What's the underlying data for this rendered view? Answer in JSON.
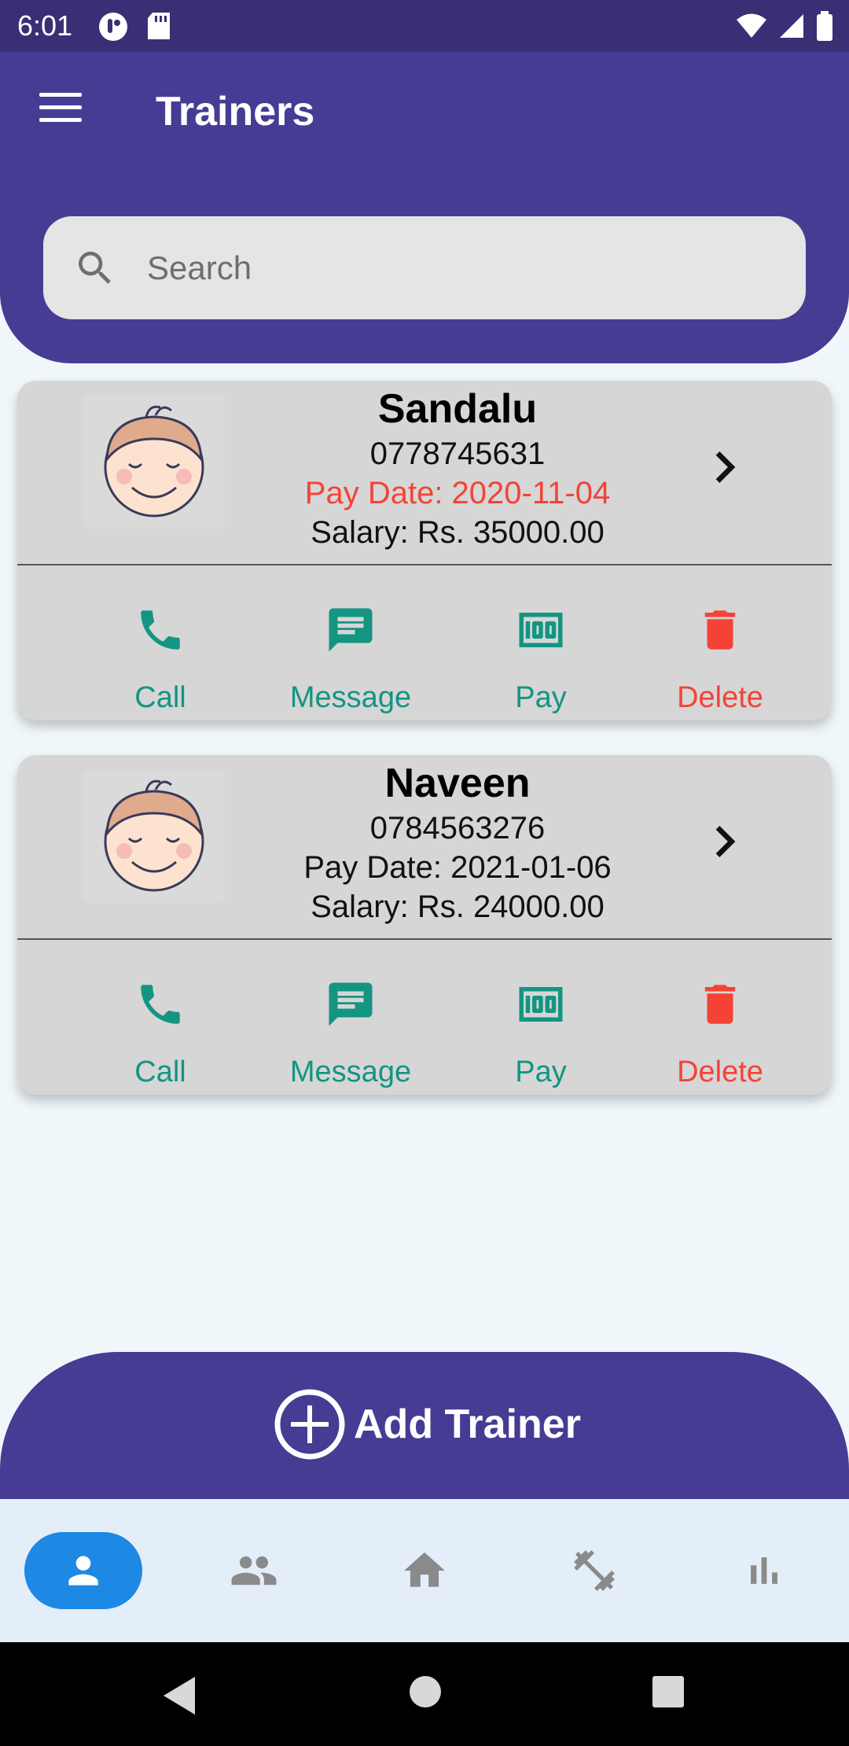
{
  "status_bar": {
    "time": "6:01"
  },
  "header": {
    "title": "Trainers",
    "search_placeholder": "Search"
  },
  "trainers": [
    {
      "name": "Sandalu",
      "phone": "0778745631",
      "pay_date": "Pay Date: 2020-11-04",
      "pay_date_color": "#f44336",
      "salary": "Salary: Rs. 35000.00"
    },
    {
      "name": "Naveen",
      "phone": "0784563276",
      "pay_date": "Pay Date: 2021-01-06",
      "pay_date_color": "#111111",
      "salary": "Salary: Rs. 24000.00"
    }
  ],
  "actions": {
    "call": "Call",
    "message": "Message",
    "pay": "Pay",
    "delete": "Delete"
  },
  "add_trainer": {
    "label": "Add Trainer"
  },
  "colors": {
    "primary": "#463c94",
    "accent_teal": "#139582",
    "danger": "#f44336",
    "nav_active": "#1e88e5",
    "nav_inactive": "#8a8a8a"
  },
  "bottom_nav": [
    {
      "icon": "person-icon",
      "active": true
    },
    {
      "icon": "group-icon",
      "active": false
    },
    {
      "icon": "home-icon",
      "active": false
    },
    {
      "icon": "fitness-icon",
      "active": false
    },
    {
      "icon": "bar-chart-icon",
      "active": false
    }
  ]
}
